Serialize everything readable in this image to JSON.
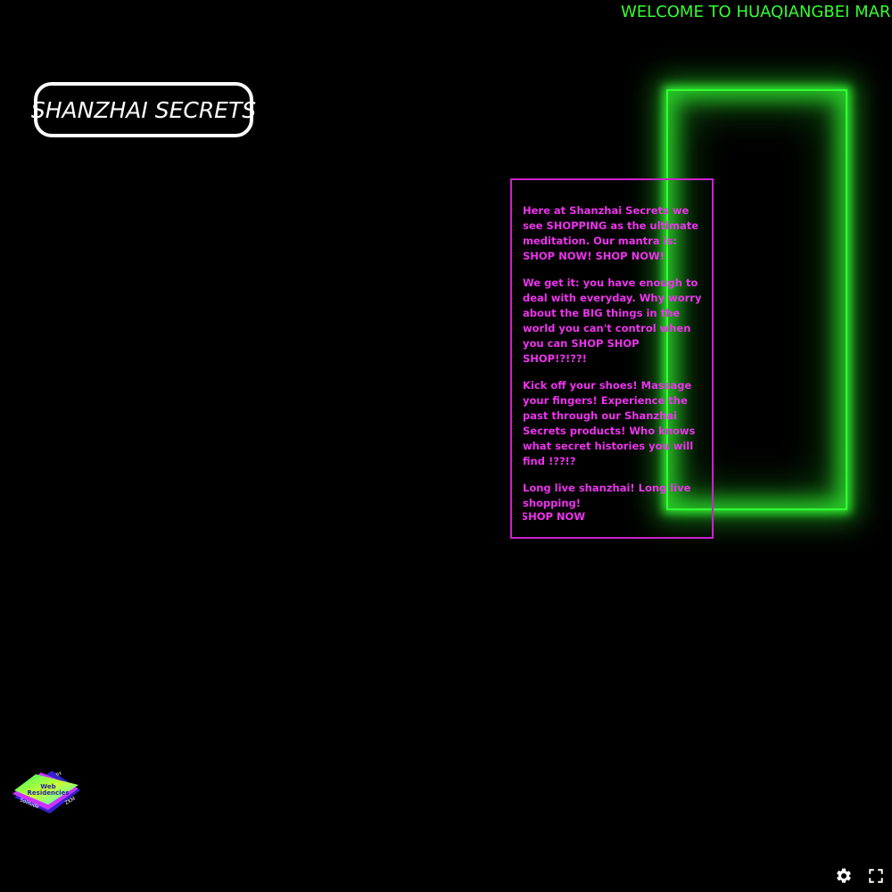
{
  "marquee": {
    "text": "WELCOME TO HUAQIANGBEI MARKET"
  },
  "header": {
    "title": "SHANZHAI SECRETS"
  },
  "copy": {
    "paragraphs": [
      "Here at Shanzhai Secrets we see SHOPPING as the ultimate meditation. Our mantra is: SHOP NOW! SHOP NOW!",
      "We get it: you have enough to deal with everyday. Why worry about the BIG things in the world you can't control when you can SHOP SHOP SHOP!?!??!",
      "Kick off your shoes! Massage your fingers! Experience the past through our Shanzhai Secrets products! Who knows what secret histories you will find !??!?",
      "Long live shanzhai! Long live shopping!"
    ],
    "shop_link": "SHOP NOW"
  },
  "badge": {
    "line1": "Web",
    "line2": "Residencies",
    "corner_top": "by",
    "corner_left": "Solitude",
    "corner_right": "ZKM"
  },
  "colors": {
    "neon_green": "#33ff33",
    "magenta": "#ee33ee",
    "background": "#000000"
  },
  "icons": {
    "settings": "gear-icon",
    "fullscreen": "fullscreen-icon"
  }
}
